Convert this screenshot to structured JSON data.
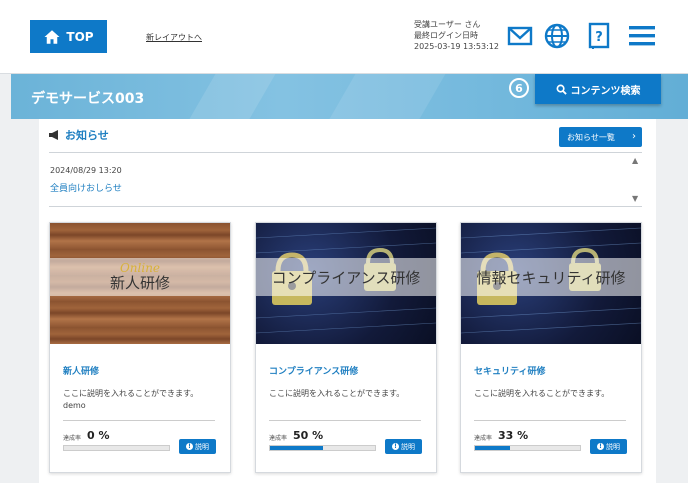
{
  "header": {
    "top_label": "TOP",
    "new_layout_link": "新レイアウトへ",
    "user_name": "受講ユーザー さん",
    "last_login_label": "最終ログイン日時",
    "last_login_value": "2025-03-19 13:53:12",
    "icons": [
      "home-icon",
      "mail-icon",
      "globe-icon",
      "help-book-icon",
      "menu-icon"
    ]
  },
  "banner": {
    "title": "デモサービス003",
    "badge": "6",
    "search_label": "コンテンツ検索"
  },
  "notice": {
    "heading": "お知らせ",
    "list_button": "お知らせ一覧",
    "items": [
      {
        "date": "2024/08/29 13:20",
        "title": "全員向けおしらせ"
      }
    ]
  },
  "cards": [
    {
      "image_overlay": "新人研修",
      "image_script": "Online",
      "title": "新人研修",
      "description": "ここに説明を入れることができます。",
      "sub": "demo",
      "rate_label": "達成率",
      "rate_text": "0 %",
      "rate_value": 0,
      "explain_label": "説明"
    },
    {
      "image_overlay": "コンプライアンス研修",
      "title": "コンプライアンス研修",
      "description": "ここに説明を入れることができます。",
      "sub": "",
      "rate_label": "達成率",
      "rate_text": "50 %",
      "rate_value": 50,
      "explain_label": "説明"
    },
    {
      "image_overlay": "情報セキュリティ研修",
      "title": "セキュリティ研修",
      "description": "ここに説明を入れることができます。",
      "sub": "",
      "rate_label": "達成率",
      "rate_text": "33 %",
      "rate_value": 33,
      "explain_label": "説明"
    }
  ],
  "colors": {
    "primary": "#0e79c8",
    "link": "#1f7fc1",
    "banner": "#7dbfe0"
  }
}
